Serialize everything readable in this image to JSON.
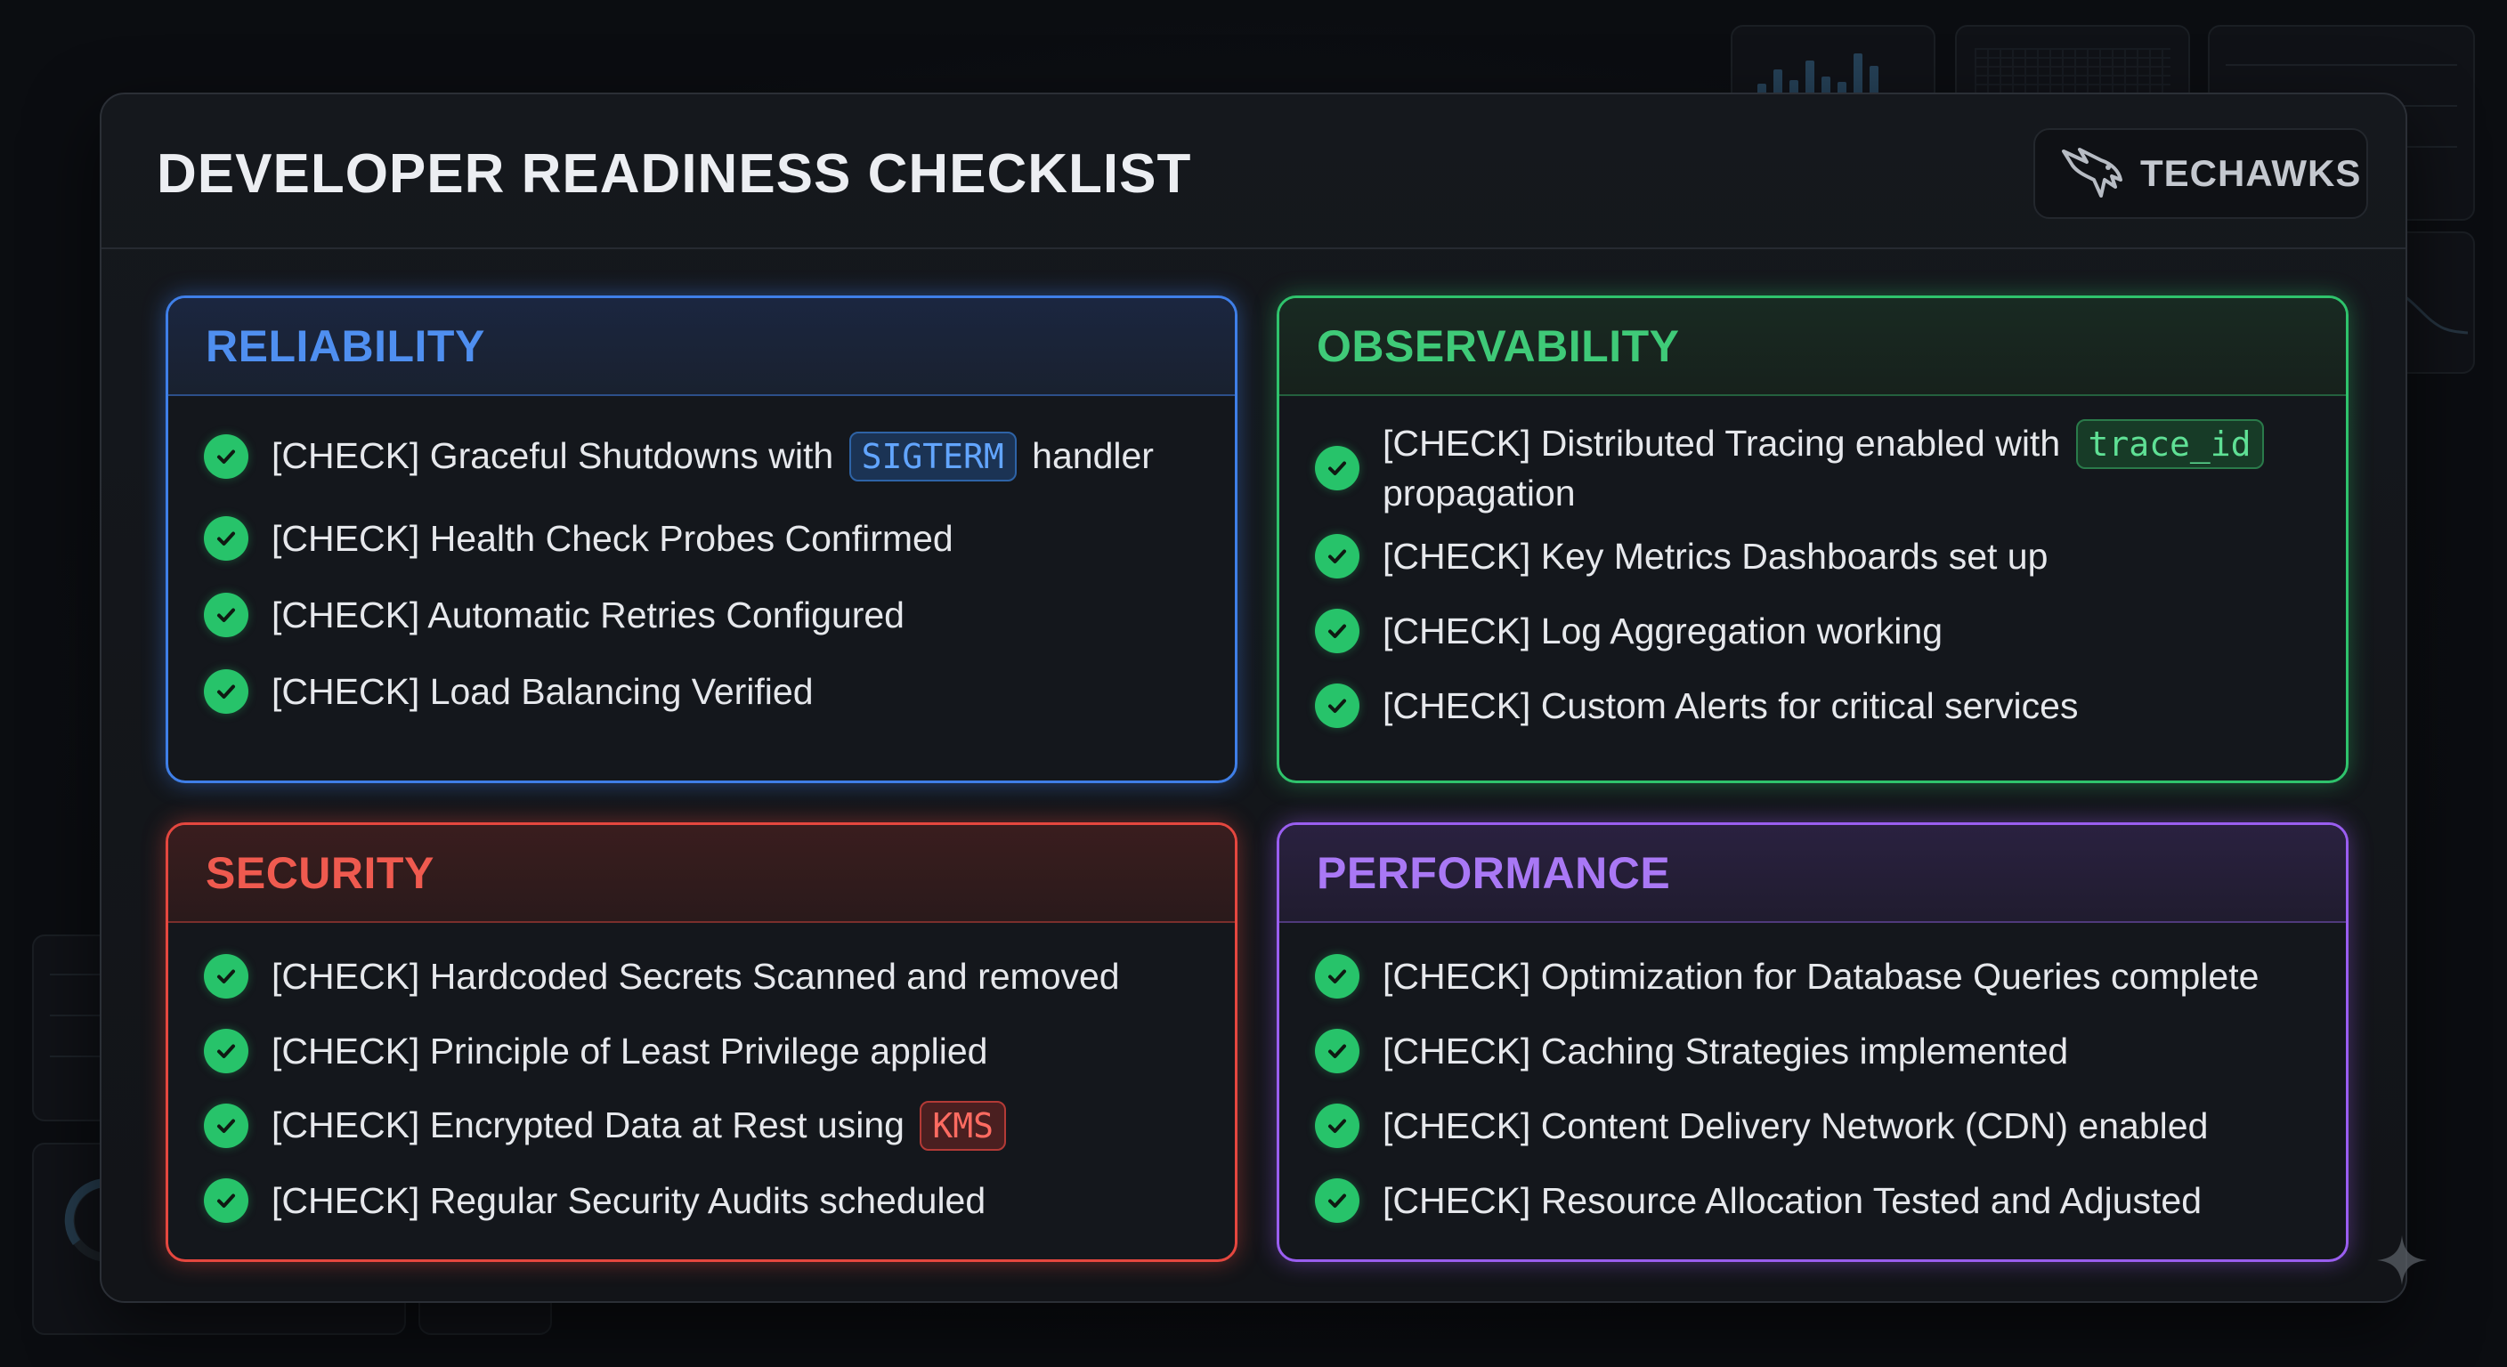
{
  "header": {
    "title": "DEVELOPER READINESS CHECKLIST",
    "brand": "TECHAWKS"
  },
  "sections": {
    "reliability": {
      "title": "RELIABILITY",
      "accent": "#4f8ff0",
      "items": [
        {
          "before": "[CHECK] Graceful Shutdowns with",
          "code": "SIGTERM",
          "after": "handler"
        },
        {
          "text": "[CHECK] Health Check Probes Confirmed"
        },
        {
          "text": "[CHECK] Automatic Retries Configured"
        },
        {
          "text": "[CHECK] Load Balancing Verified"
        }
      ]
    },
    "observability": {
      "title": "OBSERVABILITY",
      "accent": "#3fca78",
      "items": [
        {
          "before": "[CHECK] Distributed Tracing enabled with",
          "code": "trace_id",
          "after": "propagation"
        },
        {
          "text": "[CHECK] Key Metrics Dashboards set up"
        },
        {
          "text": "[CHECK] Log Aggregation working"
        },
        {
          "text": "[CHECK] Custom Alerts for critical services"
        }
      ]
    },
    "security": {
      "title": "SECURITY",
      "accent": "#ef5a4f",
      "items": [
        {
          "text": "[CHECK] Hardcoded Secrets Scanned and removed"
        },
        {
          "text": "[CHECK] Principle of Least Privilege applied"
        },
        {
          "before": "[CHECK] Encrypted Data at Rest using",
          "code": "KMS"
        },
        {
          "text": "[CHECK] Regular Security Audits scheduled"
        }
      ]
    },
    "performance": {
      "title": "PERFORMANCE",
      "accent": "#a978f5",
      "items": [
        {
          "text": "[CHECK] Optimization for Database Queries complete"
        },
        {
          "text": "[CHECK] Caching Strategies implemented"
        },
        {
          "text": "[CHECK] Content Delivery Network (CDN) enabled"
        },
        {
          "text": "[CHECK] Resource Allocation Tested and Adjusted"
        }
      ]
    }
  },
  "icons": {
    "check": "check-circle-icon",
    "brand": "hawk-logo-icon",
    "sparkle": "sparkle-icon"
  },
  "colors": {
    "check_green": "#27c36a",
    "panel_bg": "#15181d"
  }
}
